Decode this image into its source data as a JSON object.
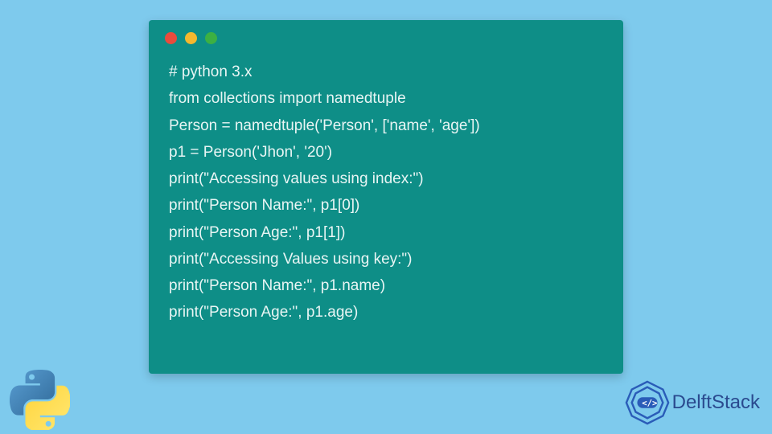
{
  "window": {
    "controls": [
      "red",
      "yellow",
      "green"
    ]
  },
  "code": {
    "lines": [
      "# python 3.x",
      "from collections import namedtuple",
      "Person = namedtuple('Person', ['name', 'age'])",
      "p1 = Person('Jhon', '20')",
      "print(\"Accessing values using index:\")",
      "print(\"Person Name:\", p1[0])",
      "print(\"Person Age:\", p1[1])",
      "print(\"Accessing Values using key:\")",
      "print(\"Person Name:\", p1.name)",
      "print(\"Person Age:\", p1.age)"
    ]
  },
  "branding": {
    "site_name": "DelftStack"
  },
  "colors": {
    "background": "#7ecaed",
    "code_bg": "#0e8e87",
    "code_text": "#e8f5f4",
    "brand_blue": "#2a4a8f"
  }
}
